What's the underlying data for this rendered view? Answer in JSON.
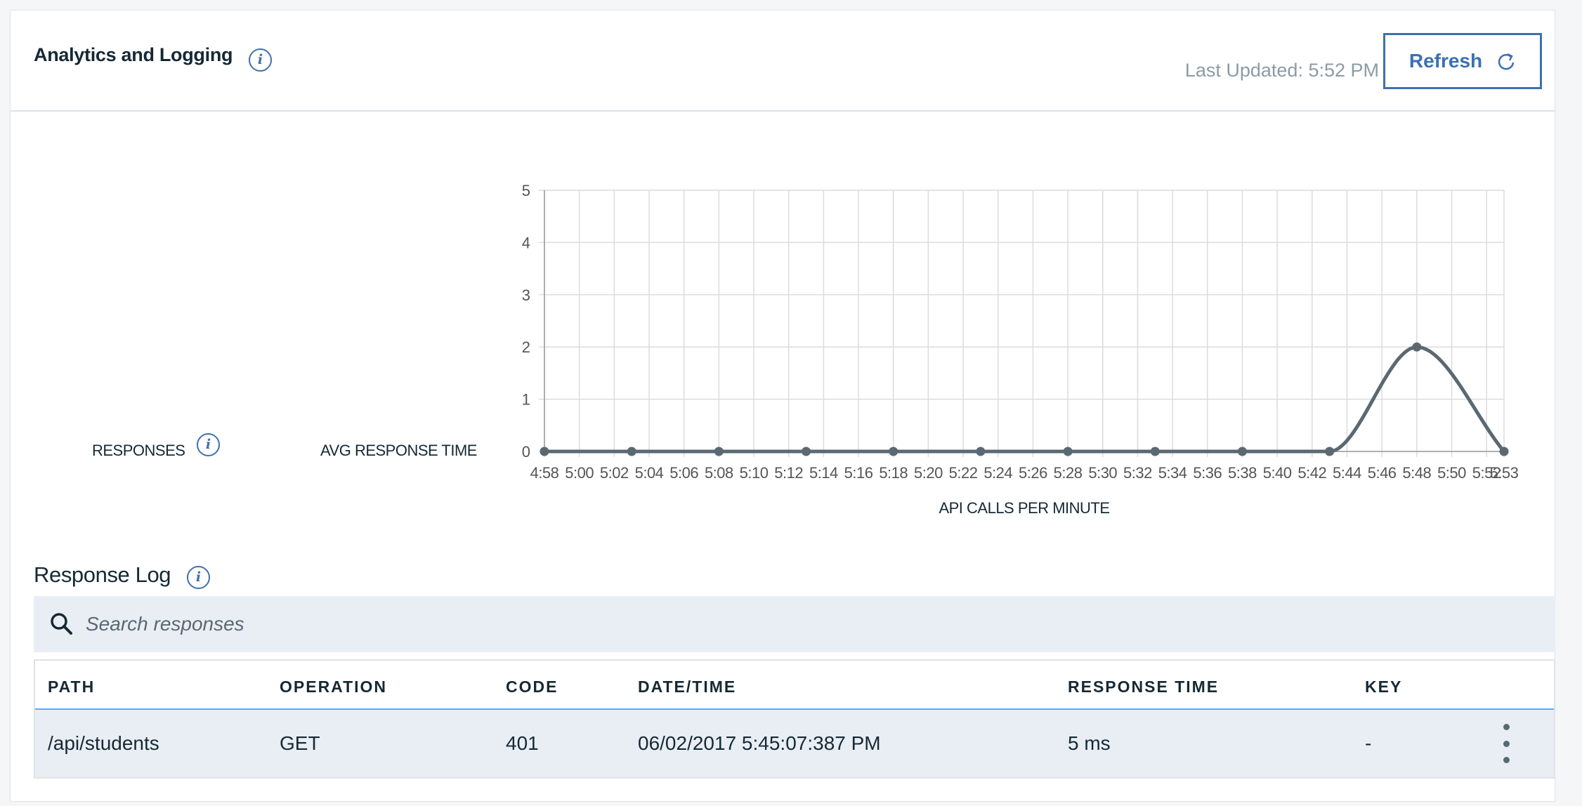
{
  "header": {
    "title": "Analytics and Logging",
    "last_updated": "Last Updated: 5:52 PM",
    "refresh_label": "Refresh"
  },
  "metrics": {
    "responses_label": "RESPONSES",
    "avg_response_time_label": "AVG RESPONSE TIME"
  },
  "chart_data": {
    "type": "line",
    "xlabel": "API CALLS PER MINUTE",
    "ylabel": "",
    "ylim": [
      0,
      5
    ],
    "y_ticks": [
      0,
      1,
      2,
      3,
      4,
      5
    ],
    "x_tick_labels": [
      "4:58",
      "5:00",
      "5:02",
      "5:04",
      "5:06",
      "5:08",
      "5:10",
      "5:12",
      "5:14",
      "5:16",
      "5:18",
      "5:20",
      "5:22",
      "5:24",
      "5:26",
      "5:28",
      "5:30",
      "5:32",
      "5:34",
      "5:36",
      "5:38",
      "5:40",
      "5:42",
      "5:44",
      "5:46",
      "5:48",
      "5:50",
      "5:52",
      "5:53"
    ],
    "x_tick_minutes": [
      0,
      2,
      4,
      6,
      8,
      10,
      12,
      14,
      16,
      18,
      20,
      22,
      24,
      26,
      28,
      30,
      32,
      34,
      36,
      38,
      40,
      42,
      44,
      46,
      48,
      50,
      52,
      54,
      55
    ],
    "series": [
      {
        "points": [
          {
            "x": "4:58",
            "y": 0
          },
          {
            "x": "5:03",
            "y": 0
          },
          {
            "x": "5:08",
            "y": 0
          },
          {
            "x": "5:13",
            "y": 0
          },
          {
            "x": "5:18",
            "y": 0
          },
          {
            "x": "5:23",
            "y": 0
          },
          {
            "x": "5:28",
            "y": 0
          },
          {
            "x": "5:33",
            "y": 0
          },
          {
            "x": "5:38",
            "y": 0
          },
          {
            "x": "5:43",
            "y": 0
          },
          {
            "x": "5:48",
            "y": 2
          },
          {
            "x": "5:53",
            "y": 0
          }
        ],
        "x_minutes": [
          0,
          5,
          10,
          15,
          20,
          25,
          30,
          35,
          40,
          45,
          50,
          55
        ],
        "y": [
          0,
          0,
          0,
          0,
          0,
          0,
          0,
          0,
          0,
          0,
          2,
          0
        ],
        "color": "#5a6872"
      }
    ],
    "grid": true,
    "legend": "none"
  },
  "log": {
    "title": "Response Log",
    "search_placeholder": "Search responses",
    "columns": [
      "PATH",
      "OPERATION",
      "CODE",
      "DATE/TIME",
      "RESPONSE TIME",
      "KEY"
    ],
    "rows": [
      {
        "path": "/api/students",
        "operation": "GET",
        "code": "401",
        "datetime": "06/02/2017 5:45:07:387 PM",
        "response_time": "5 ms",
        "key": "-"
      }
    ]
  },
  "colors": {
    "accent": "#3d70b2",
    "line": "#5a6872",
    "header_border": "#5aaafa",
    "row_bg": "#e9eef5"
  },
  "icons": {
    "info": "info-icon",
    "refresh": "refresh-icon",
    "search": "search-icon",
    "overflow": "overflow-menu-icon"
  }
}
